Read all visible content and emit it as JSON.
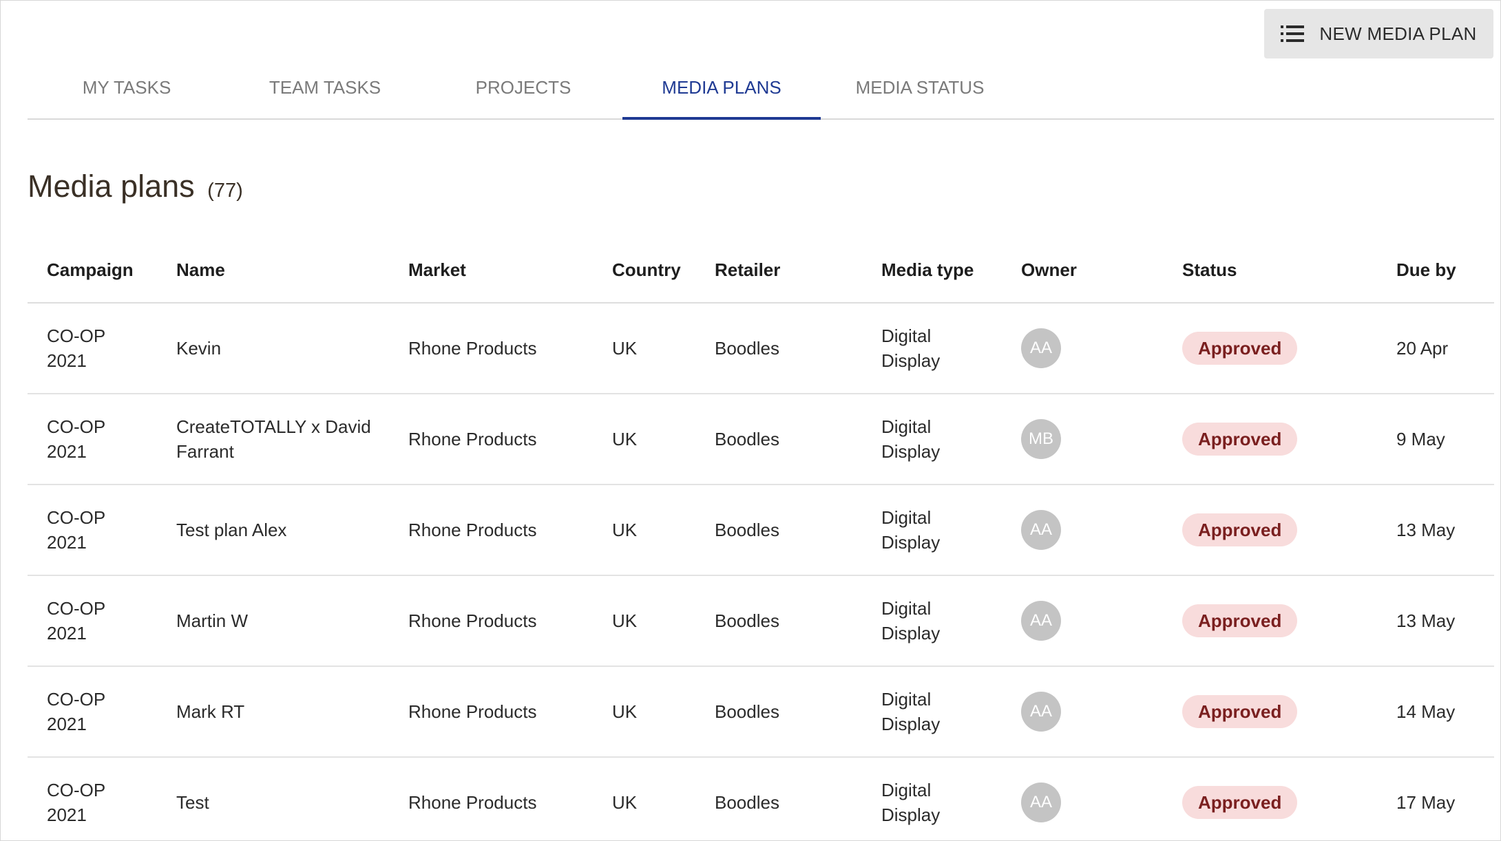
{
  "header": {
    "new_button_label": "NEW MEDIA PLAN",
    "new_button_icon": "list-icon"
  },
  "tabs": [
    {
      "label": "MY TASKS",
      "active": false
    },
    {
      "label": "TEAM TASKS",
      "active": false
    },
    {
      "label": "PROJECTS",
      "active": false
    },
    {
      "label": "MEDIA PLANS",
      "active": true
    },
    {
      "label": "MEDIA STATUS",
      "active": false
    }
  ],
  "page": {
    "title": "Media plans",
    "count": "(77)"
  },
  "table": {
    "columns": [
      "Campaign",
      "Name",
      "Market",
      "Country",
      "Retailer",
      "Media type",
      "Owner",
      "Status",
      "Due by"
    ],
    "rows": [
      {
        "campaign_line1": "CO-OP",
        "campaign_line2": "2021",
        "name": "Kevin",
        "market": "Rhone Products",
        "country": "UK",
        "retailer": "Boodles",
        "media_line1": "Digital",
        "media_line2": "Display",
        "owner": "AA",
        "status": "Approved",
        "due": "20 Apr"
      },
      {
        "campaign_line1": "CO-OP",
        "campaign_line2": "2021",
        "name": "CreateTOTALLY x David Farrant",
        "market": "Rhone Products",
        "country": "UK",
        "retailer": "Boodles",
        "media_line1": "Digital",
        "media_line2": "Display",
        "owner": "MB",
        "status": "Approved",
        "due": "9 May"
      },
      {
        "campaign_line1": "CO-OP",
        "campaign_line2": "2021",
        "name": "Test plan Alex",
        "market": "Rhone Products",
        "country": "UK",
        "retailer": "Boodles",
        "media_line1": "Digital",
        "media_line2": "Display",
        "owner": "AA",
        "status": "Approved",
        "due": "13 May"
      },
      {
        "campaign_line1": "CO-OP",
        "campaign_line2": "2021",
        "name": "Martin W",
        "market": "Rhone Products",
        "country": "UK",
        "retailer": "Boodles",
        "media_line1": "Digital",
        "media_line2": "Display",
        "owner": "AA",
        "status": "Approved",
        "due": "13 May"
      },
      {
        "campaign_line1": "CO-OP",
        "campaign_line2": "2021",
        "name": "Mark RT",
        "market": "Rhone Products",
        "country": "UK",
        "retailer": "Boodles",
        "media_line1": "Digital",
        "media_line2": "Display",
        "owner": "AA",
        "status": "Approved",
        "due": "14 May"
      },
      {
        "campaign_line1": "CO-OP",
        "campaign_line2": "2021",
        "name": "Test",
        "market": "Rhone Products",
        "country": "UK",
        "retailer": "Boodles",
        "media_line1": "Digital",
        "media_line2": "Display",
        "owner": "AA",
        "status": "Approved",
        "due": "17 May"
      }
    ]
  },
  "colors": {
    "accent": "#1f3a93",
    "badge_bg": "#f8dcdc",
    "badge_text": "#7a1f1f",
    "avatar_bg": "#c4c4c4"
  }
}
